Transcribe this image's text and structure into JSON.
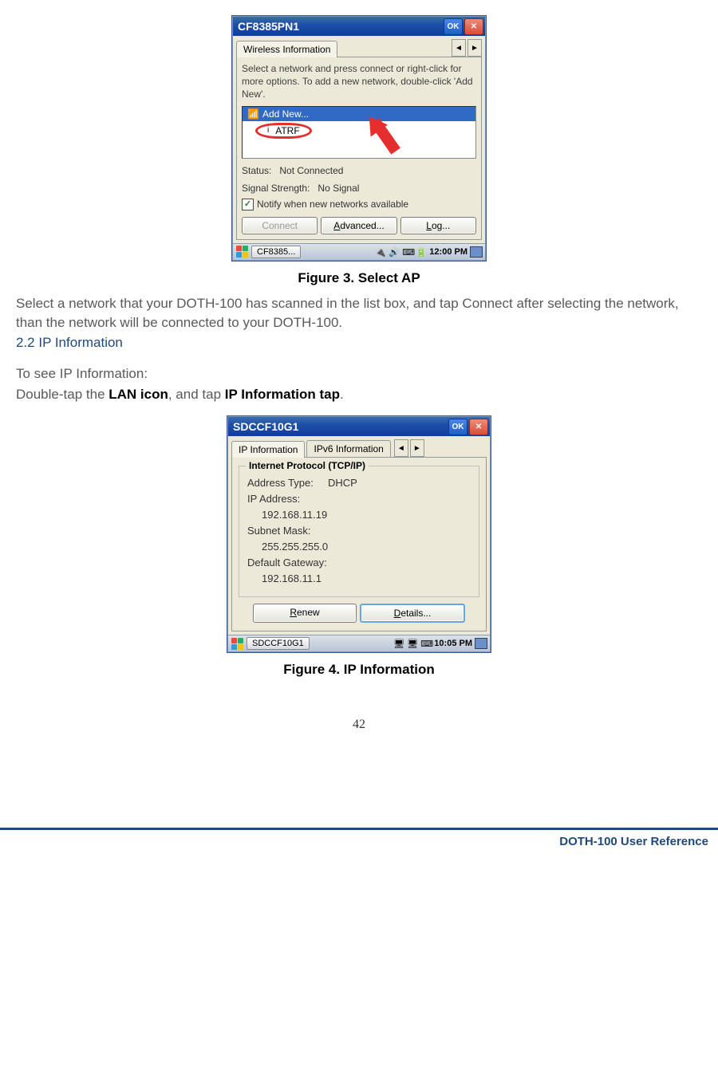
{
  "figure1": {
    "window_title": "CF8385PN1",
    "ok_label": "OK",
    "tab_label": "Wireless Information",
    "instructions": "Select a network and press connect or right-click for more options.  To add a new network, double-click 'Add New'.",
    "list": {
      "add_new": "Add New...",
      "network1": "ATRF"
    },
    "status_label": "Status:",
    "status_value": "Not Connected",
    "signal_label": "Signal Strength:",
    "signal_value": "No Signal",
    "notify_label": "Notify when new networks available",
    "btn_connect": "Connect",
    "btn_advanced": "Advanced...",
    "btn_log": "Log...",
    "taskbar_app": "CF8385...",
    "taskbar_time": "12:00 PM"
  },
  "caption1": "Figure 3. Select AP",
  "paragraph1": "Select a network that your DOTH-100 has scanned in the list box, and tap Connect after selecting the network, than the network will be connected to your DOTH-100.",
  "section_heading": "2.2 IP Information",
  "paragraph2": "To see IP Information:",
  "paragraph3_pre": "Double-tap the ",
  "lan_icon_text": "LAN icon",
  "paragraph3_mid": ", and tap ",
  "ip_tap_text": "IP Information tap",
  "paragraph3_post": ".",
  "figure2": {
    "window_title": "SDCCF10G1",
    "ok_label": "OK",
    "tab1": "IP Information",
    "tab2": "IPv6 Information",
    "legend": "Internet Protocol (TCP/IP)",
    "addr_type_label": "Address Type:",
    "addr_type_value": "DHCP",
    "ip_label": "IP Address:",
    "ip_value": "192.168.11.19",
    "subnet_label": "Subnet Mask:",
    "subnet_value": "255.255.255.0",
    "gateway_label": "Default Gateway:",
    "gateway_value": "192.168.11.1",
    "btn_renew": "Renew",
    "btn_details": "Details...",
    "taskbar_app": "SDCCF10G1",
    "taskbar_time": "10:05 PM"
  },
  "caption2": "Figure 4. IP Information",
  "page_number": "42",
  "footer_text": "DOTH-100 User Reference"
}
